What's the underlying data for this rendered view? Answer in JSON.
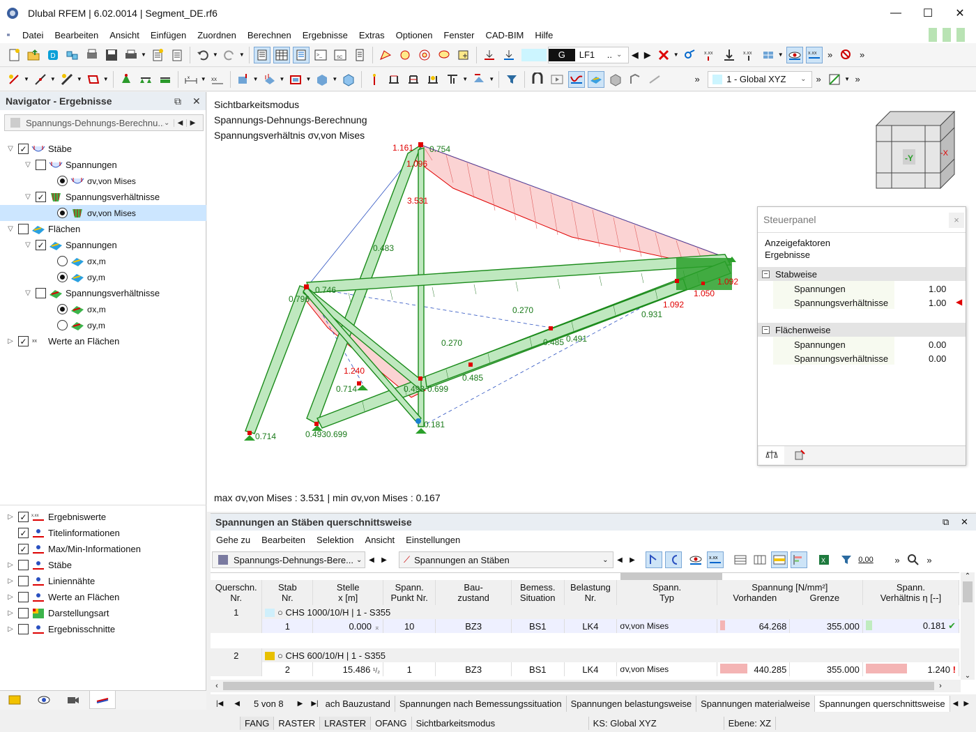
{
  "window": {
    "title": "Dlubal RFEM | 6.02.0014 | Segment_DE.rf6",
    "min": "—",
    "max": "☐",
    "close": "✕"
  },
  "menu": [
    "Datei",
    "Bearbeiten",
    "Ansicht",
    "Einfügen",
    "Zuordnen",
    "Berechnen",
    "Ergebnisse",
    "Extras",
    "Optionen",
    "Fenster",
    "CAD-BIM",
    "Hilfe"
  ],
  "toolbar1": {
    "lc_code": "G",
    "lc_name": "LF1",
    "lc_dots": ".."
  },
  "toolbar2": {
    "coord": "1 - Global XYZ"
  },
  "navigator": {
    "title": "Navigator - Ergebnisse",
    "combo": "Spannungs-Dehnungs-Berechnu...",
    "items": [
      {
        "label": "Stäbe"
      },
      {
        "label": "Spannungen"
      },
      {
        "label": "σv,von Mises"
      },
      {
        "label": "Spannungsverhältnisse"
      },
      {
        "label": "σv,von Mises"
      },
      {
        "label": "Flächen"
      },
      {
        "label": "Spannungen"
      },
      {
        "label": "σx,m"
      },
      {
        "label": "σy,m"
      },
      {
        "label": "Spannungsverhältnisse"
      },
      {
        "label": "σx,m"
      },
      {
        "label": "σy,m"
      },
      {
        "label": "Werte an Flächen"
      }
    ],
    "lower": [
      {
        "label": "Ergebniswerte"
      },
      {
        "label": "Titelinformationen"
      },
      {
        "label": "Max/Min-Informationen"
      },
      {
        "label": "Stäbe"
      },
      {
        "label": "Liniennähte"
      },
      {
        "label": "Werte an Flächen"
      },
      {
        "label": "Darstellungsart"
      },
      {
        "label": "Ergebnisschnitte"
      }
    ]
  },
  "view": {
    "line1": "Sichtbarkeitsmodus",
    "line2": "Spannungs-Dehnungs-Berechnung",
    "line3": "Spannungsverhältnis σv,von Mises",
    "maxmin": "max σv,von Mises : 3.531 | min σv,von Mises : 0.167",
    "labels": [
      {
        "t": "1.161",
        "c": "#e00000"
      },
      {
        "t": "0.754",
        "c": "#1a7a1a"
      },
      {
        "t": "1.096",
        "c": "#e00000"
      },
      {
        "t": "3.531",
        "c": "#e00000"
      },
      {
        "t": "0.483",
        "c": "#1a7a1a"
      },
      {
        "t": "0.746",
        "c": "#1a7a1a"
      },
      {
        "t": "0.796",
        "c": "#1a7a1a"
      },
      {
        "t": "1.092",
        "c": "#e00000"
      },
      {
        "t": "1.050",
        "c": "#e00000"
      },
      {
        "t": "1.092",
        "c": "#e00000"
      },
      {
        "t": "0.931",
        "c": "#1a7a1a"
      },
      {
        "t": "0.270",
        "c": "#1a7a1a"
      },
      {
        "t": "0.485",
        "c": "#1a7a1a"
      },
      {
        "t": "0.491",
        "c": "#1a7a1a"
      },
      {
        "t": "0.270",
        "c": "#1a7a1a"
      },
      {
        "t": "1.240",
        "c": "#e00000"
      },
      {
        "t": "0.485",
        "c": "#1a7a1a"
      },
      {
        "t": "0.714",
        "c": "#1a7a1a"
      },
      {
        "t": "0.493",
        "c": "#1a7a1a"
      },
      {
        "t": "0.699",
        "c": "#1a7a1a"
      },
      {
        "t": "0.181",
        "c": "#1a7a1a"
      },
      {
        "t": "0.714",
        "c": "#1a7a1a"
      },
      {
        "t": "0.493",
        "c": "#1a7a1a"
      },
      {
        "t": "0.699",
        "c": "#1a7a1a"
      }
    ]
  },
  "cube": {
    "y": "-Y",
    "x": "-X"
  },
  "control": {
    "title": "Steuerpanel",
    "close": "×",
    "h1": "Anzeigefaktoren",
    "h2": "Ergebnisse",
    "g1": "Stabweise",
    "r1": "Spannungen",
    "v1": "1.00",
    "r2": "Spannungsverhältnisse",
    "v2": "1.00",
    "g2": "Flächenweise",
    "r3": "Spannungen",
    "v3": "0.00",
    "r4": "Spannungsverhältnisse",
    "v4": "0.00"
  },
  "table": {
    "title": "Spannungen an Stäben querschnittsweise",
    "menu": [
      "Gehe zu",
      "Bearbeiten",
      "Selektion",
      "Ansicht",
      "Einstellungen"
    ],
    "combo1": "Spannungs-Dehnungs-Bere...",
    "combo2": "Spannungen an Stäben",
    "zero_btn": "0,00",
    "h": {
      "c1a": "Querschn.",
      "c1b": "Nr.",
      "c2a": "Stab",
      "c2b": "Nr.",
      "c3a": "Stelle",
      "c3b": "x [m]",
      "c4a": "Spann.",
      "c4b": "Punkt Nr.",
      "c5a": "Bau-",
      "c5b": "zustand",
      "c6a": "Bemess.",
      "c6b": "Situation",
      "c7a": "Belastung",
      "c7b": "Nr.",
      "c8a": "Spann.",
      "c8b": "Typ",
      "c9": "Spannung [N/mm²]",
      "c9a": "Vorhanden",
      "c10a": "Grenze",
      "c11a": "Spann.",
      "c11b": "Verhältnis η [--]"
    },
    "rows": [
      {
        "cs": "1",
        "section": "CHS 1000/10/H | 1 - S355",
        "color": "#cfeffb",
        "member": "1",
        "x": "0.000",
        "xmark": "⌅",
        "pt": "10",
        "bz": "BZ3",
        "bs": "BS1",
        "lk": "LK4",
        "type": "σv,von Mises",
        "ex": "64.268",
        "lim": "355.000",
        "ratio": "0.181",
        "ok": "✔",
        "exfrac": 0.18,
        "ratiofrac": 0.15
      },
      {
        "cs": "2",
        "section": "CHS 600/10/H | 1 - S355",
        "color": "#e8c000",
        "member": "2",
        "x": "15.486",
        "xmark": "¹/₂",
        "pt": "1",
        "bz": "BZ3",
        "bs": "BS1",
        "lk": "LK4",
        "type": "σv,von Mises",
        "ex": "440.285",
        "lim": "355.000",
        "ratio": "1.240",
        "ok": "!",
        "exfrac": 1.0,
        "ratiofrac": 1.0
      }
    ],
    "pager": "5 von 8",
    "tabs": [
      "ach Bauzustand",
      "Spannungen nach Bemessungssituation",
      "Spannungen belastungsweise",
      "Spannungen materialweise",
      "Spannungen querschnittsweise"
    ]
  },
  "status": [
    "FANG",
    "RASTER",
    "LRASTER",
    "OFANG",
    "Sichtbarkeitsmodus",
    "KS: Global XYZ",
    "Ebene: XZ"
  ]
}
